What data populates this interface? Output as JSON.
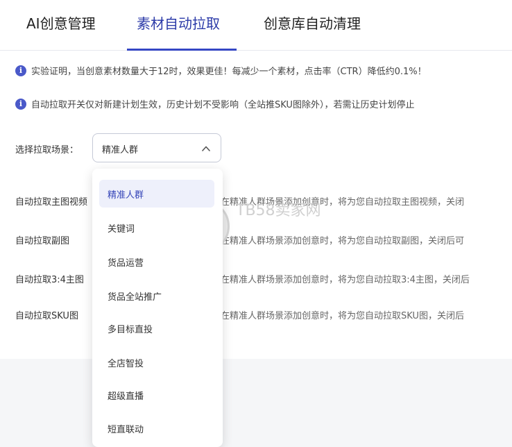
{
  "tabs": [
    {
      "label": "AI创意管理"
    },
    {
      "label": "素材自动拉取"
    },
    {
      "label": "创意库自动清理"
    }
  ],
  "notices": [
    {
      "icon": "info-icon",
      "text": "实验证明，当创意素材数量大于12时，效果更佳！每减少一个素材，点击率（CTR）降低约0.1%！"
    },
    {
      "icon": "info-icon",
      "text": "自动拉取开关仅对新建计划生效，历史计划不受影响（全站推SKU图除外），若需让历史计划停止"
    }
  ],
  "scene": {
    "label": "选择拉取场景：",
    "selected": "精准人群"
  },
  "rows": [
    {
      "label": "自动拉取主图视频",
      "desc": "在精准人群场景添加创意时，将为您自动拉取主图视频，关闭"
    },
    {
      "label": "自动拉取副图",
      "desc": "在精准人群场景添加创意时，将为您自动拉取副图，关闭后可"
    },
    {
      "label": "自动拉取3:4主图",
      "desc": "在精准人群场景添加创意时，将为您自动拉取3:4主图，关闭后"
    },
    {
      "label": "自动拉取SKU图",
      "desc": "在精准人群场景添加创意时，将为您自动拉取SKU图，关闭后"
    }
  ],
  "dropdown": {
    "options": [
      "精准人群",
      "关键词",
      "货品运营",
      "货品全站推广",
      "多目标直投",
      "全店智投",
      "超级直播",
      "短直联动"
    ]
  },
  "watermark": {
    "text": "TB58卖家网"
  },
  "colors": {
    "accent": "#3547c4",
    "selected_bg": "#eef0fb",
    "info": "#4a59c9"
  }
}
